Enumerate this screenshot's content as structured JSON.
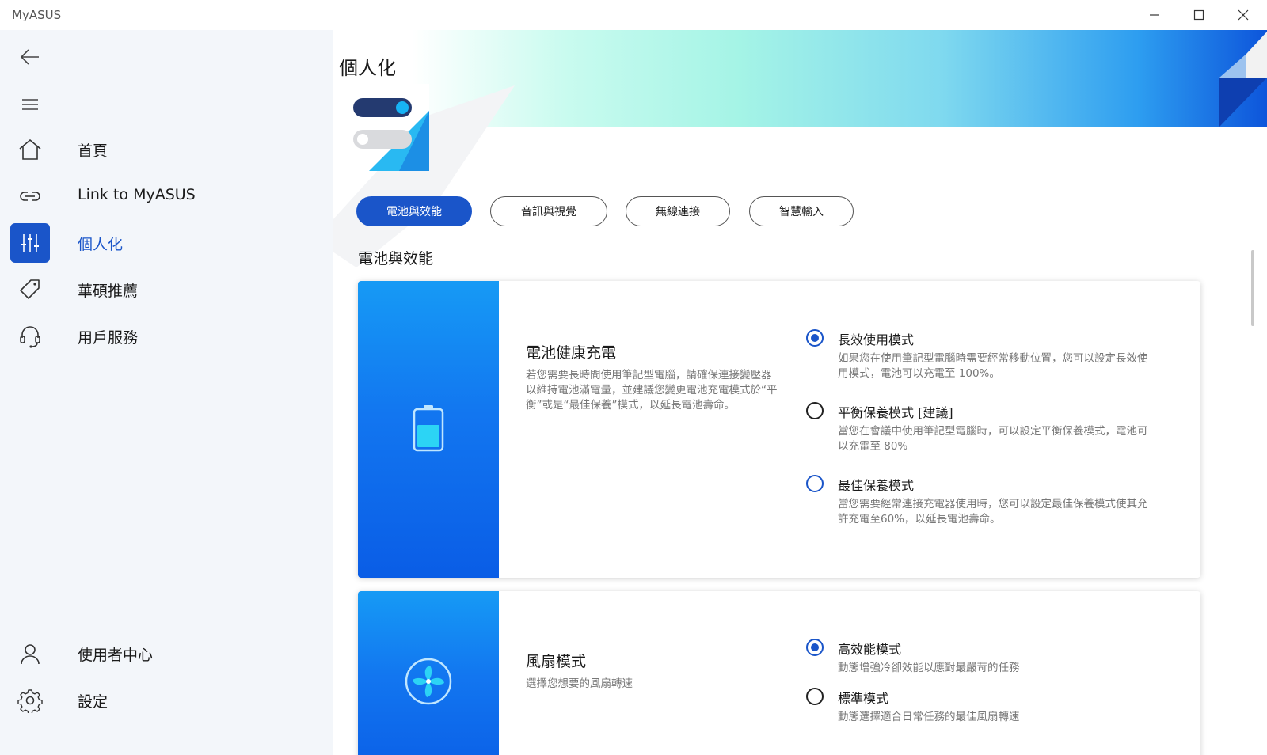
{
  "app": {
    "title": "MyASUS"
  },
  "sidebar": {
    "items": [
      {
        "label": "首頁",
        "icon": "home-icon"
      },
      {
        "label": "Link to MyASUS",
        "icon": "link-icon"
      },
      {
        "label": "個人化",
        "icon": "sliders-icon",
        "active": true
      },
      {
        "label": "華碩推薦",
        "icon": "tag-icon"
      },
      {
        "label": "用戶服務",
        "icon": "headset-icon"
      }
    ],
    "bottom_items": [
      {
        "label": "使用者中心",
        "icon": "user-icon"
      },
      {
        "label": "設定",
        "icon": "gear-icon"
      }
    ]
  },
  "main": {
    "title": "個人化",
    "tabs": [
      {
        "label": "電池與效能",
        "active": true
      },
      {
        "label": "音訊與視覺"
      },
      {
        "label": "無線連接"
      },
      {
        "label": "智慧輸入"
      }
    ],
    "section_title": "電池與效能",
    "cards": [
      {
        "icon": "battery-icon",
        "title": "電池健康充電",
        "description": "若您需要長時間使用筆記型電腦，請確保連接變壓器以維持電池滿電量，並建議您變更電池充電模式於“平衡”或是“最佳保養”模式，以延長電池壽命。",
        "options": [
          {
            "label": "長效使用模式",
            "description": "如果您在使用筆記型電腦時需要經常移動位置，您可以設定長效使用模式，電池可以充電至 100%。",
            "selected": true
          },
          {
            "label": "平衡保養模式 [建議]",
            "description": "當您在會議中使用筆記型電腦時，可以設定平衡保養模式，電池可以充電至 80%",
            "selected": false
          },
          {
            "label": "最佳保養模式",
            "description": "當您需要經常連接充電器使用時，您可以設定最佳保養模式使其允許充電至60%，以延長電池壽命。",
            "selected": false
          }
        ]
      },
      {
        "icon": "fan-icon",
        "title": "風扇模式",
        "description": "選擇您想要的風扇轉速",
        "options": [
          {
            "label": "高效能模式",
            "description": "動態增強冷卻效能以應對最嚴苛的任務",
            "selected": true
          },
          {
            "label": "標準模式",
            "description": "動態選擇適合日常任務的最佳風扇轉速",
            "selected": false
          }
        ]
      }
    ]
  },
  "colors": {
    "accent": "#1a55c9",
    "card_side_top": "#169af5",
    "card_side_bottom": "#0a5de6"
  }
}
